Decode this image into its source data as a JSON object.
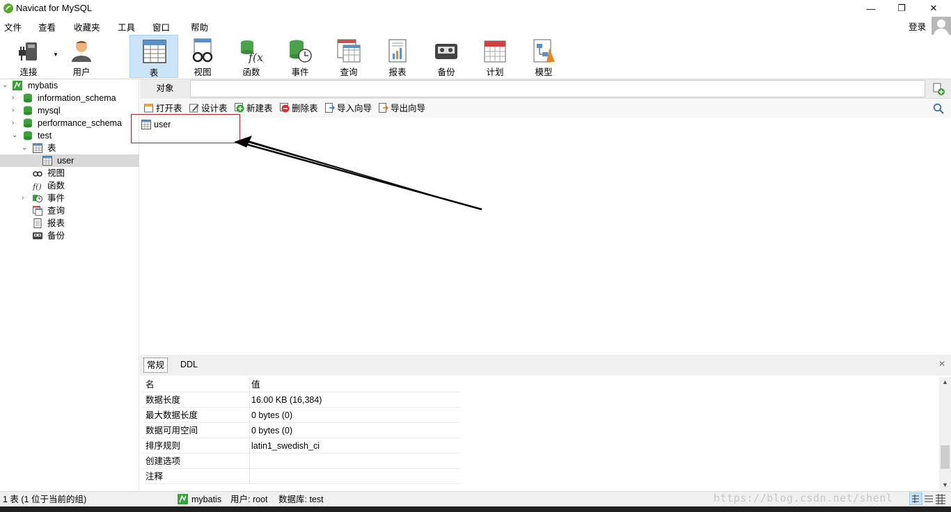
{
  "window": {
    "title": "Navicat for MySQL",
    "minimize": "—",
    "restore": "❐",
    "close": "✕"
  },
  "menu": {
    "items": [
      "文件",
      "查看",
      "收藏夹",
      "工具",
      "窗口",
      "帮助"
    ],
    "login": "登录"
  },
  "toolbar": {
    "buttons": [
      {
        "label": "连接",
        "icon": "plug-icon"
      },
      {
        "label": "用户",
        "icon": "user-icon"
      },
      {
        "label": "表",
        "icon": "table-icon",
        "active": true
      },
      {
        "label": "视图",
        "icon": "glasses-icon"
      },
      {
        "label": "函数",
        "icon": "function-icon"
      },
      {
        "label": "事件",
        "icon": "event-clock-icon"
      },
      {
        "label": "查询",
        "icon": "query-icon"
      },
      {
        "label": "报表",
        "icon": "report-icon"
      },
      {
        "label": "备份",
        "icon": "backup-icon"
      },
      {
        "label": "计划",
        "icon": "calendar-icon"
      },
      {
        "label": "模型",
        "icon": "model-icon"
      }
    ]
  },
  "tree": {
    "connection": "mybatis",
    "databases": [
      "information_schema",
      "mysql",
      "performance_schema",
      "test"
    ],
    "test_children": {
      "tables": "表",
      "table_user": "user",
      "views": "视图",
      "functions": "函数",
      "events": "事件",
      "queries": "查询",
      "reports": "报表",
      "backups": "备份"
    }
  },
  "objects": {
    "tab": "对象",
    "actions": [
      "打开表",
      "设计表",
      "新建表",
      "删除表",
      "导入向导",
      "导出向导"
    ],
    "items": [
      "user"
    ]
  },
  "info": {
    "tabs": [
      "常规",
      "DDL"
    ],
    "header": {
      "key": "名",
      "value": "值"
    },
    "rows": [
      {
        "key": "数据长度",
        "value": "16.00 KB (16,384)"
      },
      {
        "key": "最大数据长度",
        "value": "0 bytes (0)"
      },
      {
        "key": "数据可用空间",
        "value": "0 bytes (0)"
      },
      {
        "key": "排序规则",
        "value": "latin1_swedish_ci"
      },
      {
        "key": "创建选项",
        "value": ""
      },
      {
        "key": "注释",
        "value": ""
      }
    ]
  },
  "status": {
    "count": "1 表 (1 位于当前的组)",
    "connection": "mybatis",
    "user": "用户: root",
    "database": "数据库: test",
    "watermark": "https://blog.csdn.net/shenl"
  },
  "colors": {
    "accent_active": "#cce4f7",
    "db_green": "#3aa23a",
    "highlight_red": "#9b2a2a"
  }
}
